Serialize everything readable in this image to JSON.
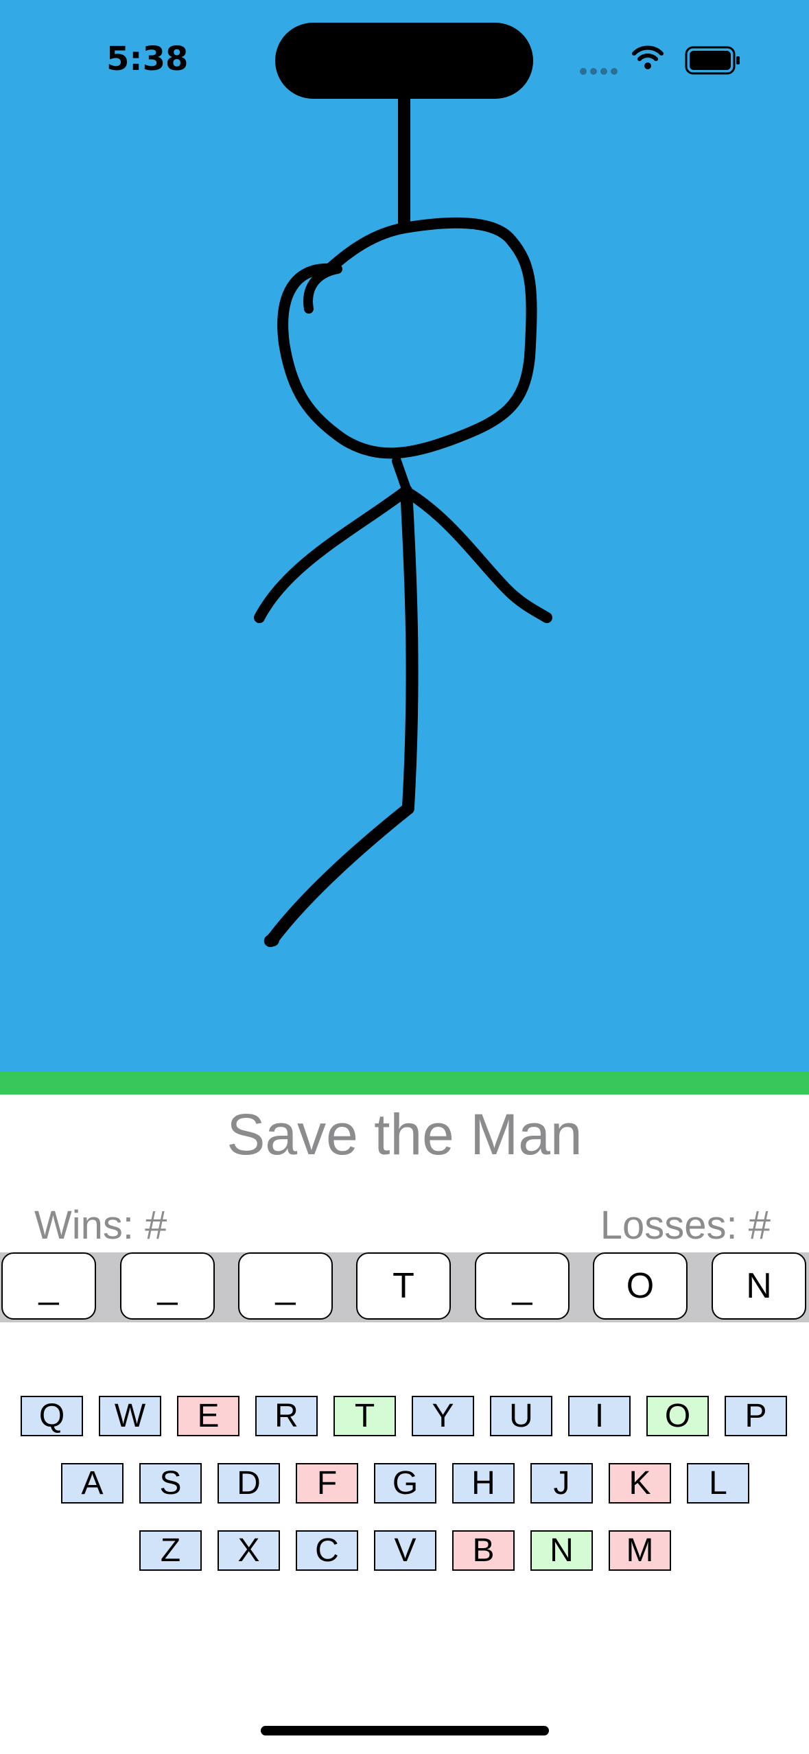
{
  "status_bar": {
    "time": "5:38"
  },
  "game": {
    "title": "Save the Man",
    "wins_label": "Wins:  #",
    "losses_label": "Losses:  #",
    "word_slots": [
      "_",
      "_",
      "_",
      "T",
      "_",
      "O",
      "N"
    ],
    "keyboard": {
      "rows": [
        [
          {
            "letter": "Q",
            "state": "unused"
          },
          {
            "letter": "W",
            "state": "unused"
          },
          {
            "letter": "E",
            "state": "wrong"
          },
          {
            "letter": "R",
            "state": "unused"
          },
          {
            "letter": "T",
            "state": "right"
          },
          {
            "letter": "Y",
            "state": "unused"
          },
          {
            "letter": "U",
            "state": "unused"
          },
          {
            "letter": "I",
            "state": "unused"
          },
          {
            "letter": "O",
            "state": "right"
          },
          {
            "letter": "P",
            "state": "unused"
          }
        ],
        [
          {
            "letter": "A",
            "state": "unused"
          },
          {
            "letter": "S",
            "state": "unused"
          },
          {
            "letter": "D",
            "state": "unused"
          },
          {
            "letter": "F",
            "state": "wrong"
          },
          {
            "letter": "G",
            "state": "unused"
          },
          {
            "letter": "H",
            "state": "unused"
          },
          {
            "letter": "J",
            "state": "unused"
          },
          {
            "letter": "K",
            "state": "wrong"
          },
          {
            "letter": "L",
            "state": "unused"
          }
        ],
        [
          {
            "letter": "Z",
            "state": "unused"
          },
          {
            "letter": "X",
            "state": "unused"
          },
          {
            "letter": "C",
            "state": "unused"
          },
          {
            "letter": "V",
            "state": "unused"
          },
          {
            "letter": "B",
            "state": "wrong"
          },
          {
            "letter": "N",
            "state": "right"
          },
          {
            "letter": "M",
            "state": "wrong"
          }
        ]
      ]
    }
  },
  "colors": {
    "sky": "#33aae5",
    "ground": "#38c75a",
    "key_unused": "#d0e3f8",
    "key_wrong": "#fcd2d4",
    "key_right": "#d5fbd5"
  },
  "icons": [
    "wifi-icon",
    "battery-icon",
    "cellular-signal-icon"
  ]
}
